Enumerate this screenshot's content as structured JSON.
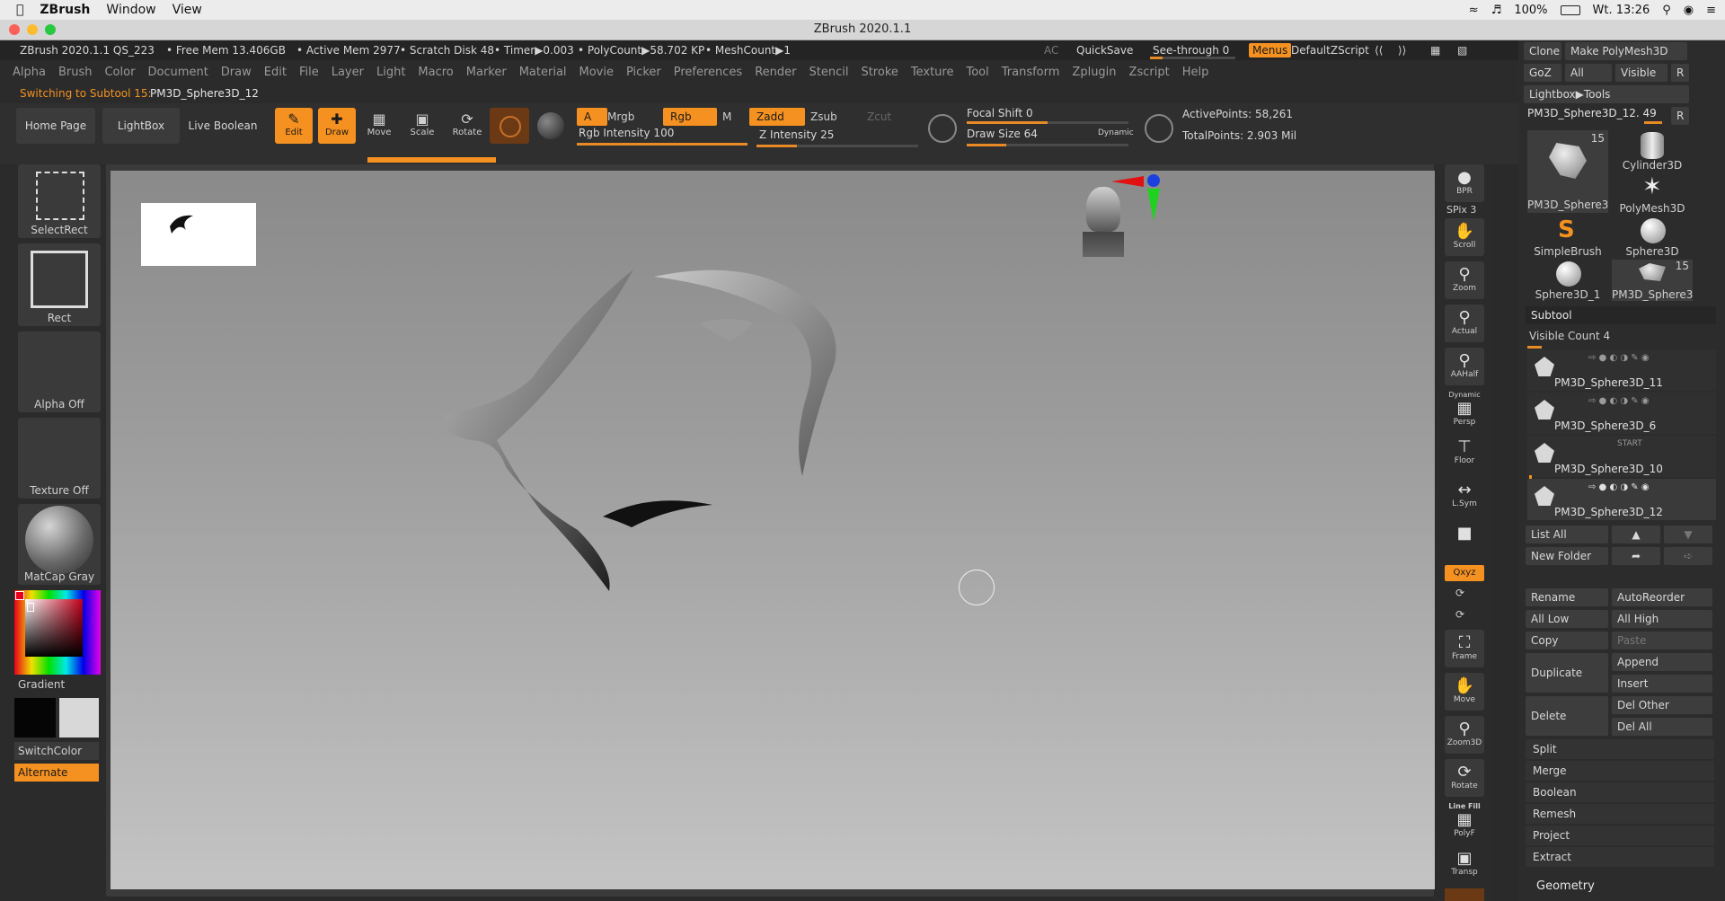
{
  "mac_menubar": {
    "app_name": "ZBrush",
    "items": [
      "Window",
      "View"
    ],
    "battery": "100%",
    "clock": "Wt. 13:26"
  },
  "window": {
    "title": "ZBrush 2020.1.1"
  },
  "infobar": {
    "version": "ZBrush 2020.1.1  QS_223",
    "free_mem": "• Free Mem 13.406GB",
    "active_mem": "• Active Mem 2977",
    "scratch_disk": "• Scratch Disk 48",
    "timer": "• Timer▶0.003",
    "polycount": "• PolyCount▶58.702 KP",
    "meshcount": "• MeshCount▶1",
    "ac": "AC",
    "quicksave": "QuickSave",
    "see_through": "See-through  0",
    "menus": "Menus",
    "default_zscript": "DefaultZScript"
  },
  "menus": [
    "Alpha",
    "Brush",
    "Color",
    "Document",
    "Draw",
    "Edit",
    "File",
    "Layer",
    "Light",
    "Macro",
    "Marker",
    "Material",
    "Movie",
    "Picker",
    "Preferences",
    "Render",
    "Stencil",
    "Stroke",
    "Texture",
    "Tool",
    "Transform",
    "Zplugin",
    "Zscript",
    "Help"
  ],
  "status": {
    "switching": "Switching to Subtool 15:",
    "subtool_name": "PM3D_Sphere3D_12"
  },
  "shelf": {
    "home_page": "Home Page",
    "lightbox": "LightBox",
    "live_boolean": "Live Boolean",
    "edit": "Edit",
    "draw": "Draw",
    "move": "Move",
    "scale": "Scale",
    "rotate": "Rotate",
    "a": "A",
    "mrgb": "Mrgb",
    "rgb": "Rgb",
    "m": "M",
    "zadd": "Zadd",
    "zsub": "Zsub",
    "zcut": "Zcut",
    "rgb_intensity": "Rgb Intensity 100",
    "z_intensity": "Z Intensity 25",
    "focal_shift": "Focal Shift 0",
    "draw_size": "Draw Size 64",
    "dynamic": "Dynamic",
    "active_points": "ActivePoints: 58,261",
    "total_points": "TotalPoints: 2.903 Mil",
    "rgb_intensity_value": 100,
    "z_intensity_value": 25,
    "focal_shift_value": 0,
    "draw_size_value": 64
  },
  "left_panel": {
    "select_rect": "SelectRect",
    "rect": "Rect",
    "alpha_off": "Alpha Off",
    "texture_off": "Texture Off",
    "matcap": "MatCap Gray",
    "gradient": "Gradient",
    "switch_color": "SwitchColor",
    "alternate": "Alternate"
  },
  "right_tools": {
    "bpr": "BPR",
    "spix": "SPix 3",
    "scroll": "Scroll",
    "zoom": "Zoom",
    "actual": "Actual",
    "aahalf": "AAHalf",
    "dynamic": "Dynamic",
    "persp": "Persp",
    "floor": "Floor",
    "lsym": "L.Sym",
    "xyz": "Qxyz",
    "frame": "Frame",
    "move": "Move",
    "zoom3d": "Zoom3D",
    "rotate": "Rotate",
    "line_fill": "Line Fill",
    "polyf": "PolyF",
    "transp": "Transp"
  },
  "right_panel": {
    "clone": "Clone",
    "make_polymesh": "Make PolyMesh3D",
    "goz": "GoZ",
    "all": "All",
    "visible": "Visible",
    "r": "R",
    "lightbox_tools": "Lightbox▶Tools",
    "current_tool": "PM3D_Sphere3D_12. 49",
    "tools": [
      {
        "name": "PM3D_Sphere3",
        "badge": "15"
      },
      {
        "name": "Cylinder3D",
        "badge": ""
      },
      {
        "name": "PolyMesh3D",
        "badge": ""
      },
      {
        "name": "SimpleBrush",
        "badge": ""
      },
      {
        "name": "Sphere3D",
        "badge": ""
      },
      {
        "name": "Sphere3D_1",
        "badge": ""
      },
      {
        "name": "PM3D_Sphere3",
        "badge": "15"
      }
    ],
    "subtool_header": "Subtool",
    "visible_count": "Visible Count 4",
    "subtools": [
      {
        "name": "PM3D_Sphere3D_11",
        "extra": ""
      },
      {
        "name": "PM3D_Sphere3D_6",
        "extra": ""
      },
      {
        "name": "PM3D_Sphere3D_10",
        "extra": "START"
      },
      {
        "name": "PM3D_Sphere3D_12",
        "extra": ""
      }
    ],
    "list_all": "List All",
    "new_folder": "New Folder",
    "rename": "Rename",
    "autoreorder": "AutoReorder",
    "all_low": "All Low",
    "all_high": "All High",
    "copy": "Copy",
    "paste": "Paste",
    "duplicate": "Duplicate",
    "append": "Append",
    "insert": "Insert",
    "delete": "Delete",
    "del_other": "Del Other",
    "del_all": "Del All",
    "split": "Split",
    "merge": "Merge",
    "boolean": "Boolean",
    "remesh": "Remesh",
    "project": "Project",
    "extract": "Extract",
    "geometry": "Geometry"
  },
  "colors": {
    "accent": "#f59120",
    "panel": "#2b2b2b",
    "canvas_top": "#8a8a8a",
    "canvas_bottom": "#c4c4c4"
  }
}
